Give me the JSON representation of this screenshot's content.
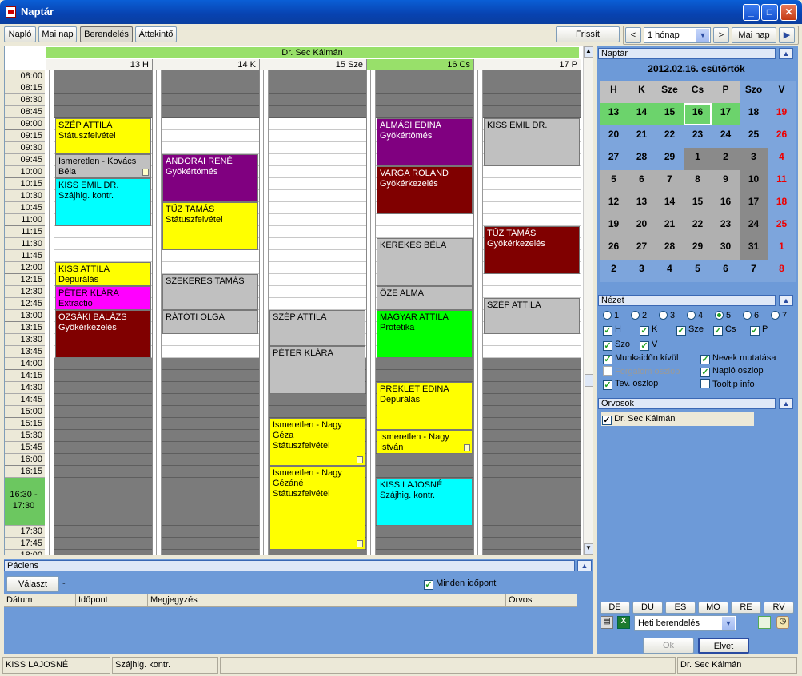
{
  "window": {
    "title": "Naptár"
  },
  "toolbar": {
    "tabs": [
      "Napló",
      "Mai nap",
      "Berendelés",
      "Áttekintő"
    ],
    "refresh": "Frissít",
    "range": "1 hónap",
    "today": "Mai nap"
  },
  "calendar": {
    "doctor": "Dr. Sec Kálmán",
    "days": [
      {
        "label": "13 H"
      },
      {
        "label": "14 K"
      },
      {
        "label": "15 Sze"
      },
      {
        "label": "16 Cs"
      },
      {
        "label": "17 P"
      }
    ],
    "times": [
      "08:00",
      "08:15",
      "08:30",
      "08:45",
      "09:00",
      "09:15",
      "09:30",
      "09:45",
      "10:00",
      "10:15",
      "10:30",
      "10:45",
      "11:00",
      "11:15",
      "11:30",
      "11:45",
      "12:00",
      "12:15",
      "12:30",
      "12:45",
      "13:00",
      "13:15",
      "13:30",
      "13:45",
      "14:00",
      "14:15",
      "14:30",
      "14:45",
      "15:00",
      "15:15",
      "15:30",
      "15:45",
      "16:00",
      "16:15",
      "16:30 - 17:30",
      "17:30",
      "17:45",
      "18:00"
    ],
    "events": [
      {
        "day": 0,
        "start": 4,
        "len": 3,
        "color": "#ffff00",
        "name": "SZÉP ATTILA",
        "desc": "Státuszfelvétel"
      },
      {
        "day": 0,
        "start": 7,
        "len": 2,
        "color": "#c0c0c0",
        "name": "Ismeretlen - Kovács Béla",
        "desc": "",
        "note": true
      },
      {
        "day": 0,
        "start": 9,
        "len": 4,
        "color": "#00ffff",
        "name": "KISS EMIL DR.",
        "desc": "Szájhig. kontr."
      },
      {
        "day": 0,
        "start": 16,
        "len": 2,
        "color": "#ffff00",
        "name": "KISS ATTILA",
        "desc": "Depurálás"
      },
      {
        "day": 0,
        "start": 18,
        "len": 2,
        "color": "#ff00ff",
        "name": "PÉTER KLÁRA",
        "desc": "Extractio"
      },
      {
        "day": 0,
        "start": 20,
        "len": 4,
        "color": "#800000",
        "fg": "#fff",
        "name": "OZSÁKI BALÁZS",
        "desc": "Gyökérkezelés"
      },
      {
        "day": 1,
        "start": 7,
        "len": 4,
        "color": "#800080",
        "fg": "#fff",
        "name": "ANDORAI RENÉ",
        "desc": "Gyökértömés"
      },
      {
        "day": 1,
        "start": 11,
        "len": 4,
        "color": "#ffff00",
        "name": "TŰZ TAMÁS",
        "desc": "Státuszfelvétel"
      },
      {
        "day": 1,
        "start": 17,
        "len": 3,
        "color": "#c0c0c0",
        "name": "SZEKERES TAMÁS",
        "desc": ""
      },
      {
        "day": 1,
        "start": 20,
        "len": 2,
        "color": "#c0c0c0",
        "name": "RÁTÓTI OLGA",
        "desc": ""
      },
      {
        "day": 2,
        "start": 20,
        "len": 3,
        "color": "#c0c0c0",
        "name": "SZÉP ATTILA",
        "desc": ""
      },
      {
        "day": 2,
        "start": 23,
        "len": 4,
        "color": "#c0c0c0",
        "name": "PÉTER KLÁRA",
        "desc": ""
      },
      {
        "day": 2,
        "start": 29,
        "len": 4,
        "color": "#ffff00",
        "name": "Ismeretlen - Nagy Géza",
        "desc": "Státuszfelvétel",
        "note": true
      },
      {
        "day": 2,
        "start": 33,
        "len": 4,
        "color": "#ffff00",
        "name": "Ismeretlen - Nagy Gézáné",
        "desc": "Státuszfelvétel",
        "note": true
      },
      {
        "day": 3,
        "start": 4,
        "len": 4,
        "color": "#800080",
        "fg": "#fff",
        "name": "ALMÁSI EDINA",
        "desc": "Gyökértömés"
      },
      {
        "day": 3,
        "start": 8,
        "len": 4,
        "color": "#800000",
        "fg": "#fff",
        "name": "VARGA ROLAND",
        "desc": "Gyökérkezelés"
      },
      {
        "day": 3,
        "start": 14,
        "len": 4,
        "color": "#c0c0c0",
        "name": "KEREKES BÉLA",
        "desc": ""
      },
      {
        "day": 3,
        "start": 18,
        "len": 2,
        "color": "#c0c0c0",
        "name": "ŐZE ALMA",
        "desc": ""
      },
      {
        "day": 3,
        "start": 20,
        "len": 4,
        "color": "#00ff00",
        "name": "MAGYAR ATTILA",
        "desc": "Protetika"
      },
      {
        "day": 3,
        "start": 26,
        "len": 4,
        "color": "#ffff00",
        "name": "PREKLET EDINA",
        "desc": "Depurálás"
      },
      {
        "day": 3,
        "start": 30,
        "len": 2,
        "color": "#ffff00",
        "name": "Ismeretlen - Nagy István",
        "desc": "",
        "note": true
      },
      {
        "day": 3,
        "start": 34,
        "len": 4,
        "color": "#00ffff",
        "name": "KISS LAJOSNÉ",
        "desc": "Szájhig. kontr."
      },
      {
        "day": 4,
        "start": 4,
        "len": 4,
        "color": "#c0c0c0",
        "name": "KISS EMIL DR.",
        "desc": ""
      },
      {
        "day": 4,
        "start": 13,
        "len": 4,
        "color": "#800000",
        "fg": "#fff",
        "name": "TŰZ TAMÁS",
        "desc": "Gyökérkezelés"
      },
      {
        "day": 4,
        "start": 19,
        "len": 3,
        "color": "#c0c0c0",
        "name": "SZÉP ATTILA",
        "desc": ""
      }
    ]
  },
  "minical": {
    "title": "Naptár",
    "date": "2012.02.16. csütörtök",
    "weekdays": [
      "H",
      "K",
      "Sze",
      "Cs",
      "P",
      "Szo",
      "V"
    ],
    "weeks": [
      [
        "13",
        "14",
        "15",
        "16",
        "17",
        "18",
        "19"
      ],
      [
        "20",
        "21",
        "22",
        "23",
        "24",
        "25",
        "26"
      ],
      [
        "27",
        "28",
        "29",
        "1",
        "2",
        "3",
        "4"
      ],
      [
        "5",
        "6",
        "7",
        "8",
        "9",
        "10",
        "11"
      ],
      [
        "12",
        "13",
        "14",
        "15",
        "16",
        "17",
        "18"
      ],
      [
        "19",
        "20",
        "21",
        "22",
        "23",
        "24",
        "25"
      ],
      [
        "26",
        "27",
        "28",
        "29",
        "30",
        "31",
        "1"
      ],
      [
        "2",
        "3",
        "4",
        "5",
        "6",
        "7",
        "8"
      ]
    ]
  },
  "view": {
    "title": "Nézet",
    "radios": [
      "1",
      "2",
      "3",
      "4",
      "5",
      "6",
      "7"
    ],
    "selected": "5",
    "days": [
      "H",
      "K",
      "Sze",
      "Cs",
      "P",
      "Szo",
      "V"
    ],
    "options": [
      {
        "label": "Munkaidőn kívül",
        "checked": true
      },
      {
        "label": "Nevek mutatása",
        "checked": true
      },
      {
        "label": "Forgalom oszlop",
        "checked": false,
        "disabled": true
      },
      {
        "label": "Napló oszlop",
        "checked": true
      },
      {
        "label": "Tev. oszlop",
        "checked": true
      },
      {
        "label": "Tooltip info",
        "checked": false
      }
    ]
  },
  "doctors": {
    "title": "Orvosok",
    "items": [
      "Dr. Sec Kálmán"
    ]
  },
  "bottomTabs": [
    "DE",
    "DU",
    "ES",
    "MO",
    "RE",
    "RV"
  ],
  "schedule": "Heti berendelés",
  "ok": "Ok",
  "cancel": "Elvet",
  "patient": {
    "title": "Páciens",
    "choose": "Választ",
    "dash": "-",
    "allLabel": "Minden időpont",
    "columns": [
      "Dátum",
      "Időpont",
      "Megjegyzés",
      "Orvos"
    ]
  },
  "status": [
    "KISS LAJOSNÉ",
    "Szájhig. kontr.",
    "",
    "Dr. Sec Kálmán"
  ]
}
